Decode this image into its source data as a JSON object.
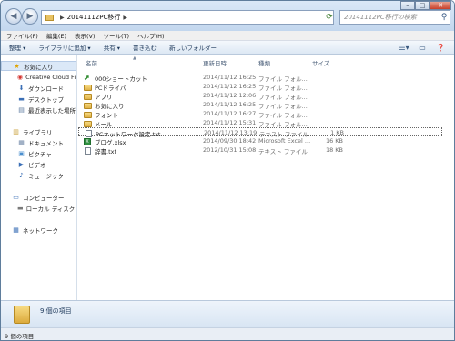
{
  "address": {
    "folder": "20141112PC移行"
  },
  "search": {
    "placeholder": "20141112PC移行の検索"
  },
  "menu": [
    "ファイル(F)",
    "編集(E)",
    "表示(V)",
    "ツール(T)",
    "ヘルプ(H)"
  ],
  "toolbar": [
    "整理 ▾",
    "ライブラリに追加 ▾",
    "共有 ▾",
    "書き込む",
    "新しいフォルダー"
  ],
  "nav": {
    "favorites": "お気に入り",
    "creative_cloud": "Creative Cloud Files",
    "downloads": "ダウンロード",
    "desktop": "デスクトップ",
    "recent": "最近表示した場所",
    "libraries": "ライブラリ",
    "documents": "ドキュメント",
    "pictures": "ピクチャ",
    "videos": "ビデオ",
    "music": "ミュージック",
    "computer": "コンピューター",
    "local_disk": "ローカル ディスク (C:)",
    "network": "ネットワーク"
  },
  "columns": {
    "name": "名前",
    "date": "更新日時",
    "type": "種類",
    "size": "サイズ"
  },
  "files": [
    {
      "name": "000ショートカット",
      "date": "2014/11/12 16:25",
      "type": "ファイル フォル...",
      "size": "",
      "icon": "shortcut-icon"
    },
    {
      "name": "PCドライバ",
      "date": "2014/11/12 16:25",
      "type": "ファイル フォル...",
      "size": "",
      "icon": "folder-icon"
    },
    {
      "name": "アプリ",
      "date": "2014/11/12 12:06",
      "type": "ファイル フォル...",
      "size": "",
      "icon": "folder-icon"
    },
    {
      "name": "お気に入り",
      "date": "2014/11/12 16:25",
      "type": "ファイル フォル...",
      "size": "",
      "icon": "folder-icon"
    },
    {
      "name": "フォント",
      "date": "2014/11/12 16:27",
      "type": "ファイル フォル...",
      "size": "",
      "icon": "folder-icon"
    },
    {
      "name": "メール",
      "date": "2014/11/12 15:31",
      "type": "ファイル フォル...",
      "size": "",
      "icon": "folder-icon"
    },
    {
      "name": "PCネットワーク設定.txt",
      "date": "2014/11/12 13:19",
      "type": "テキスト ファイル",
      "size": "1 KB",
      "icon": "text-file-icon"
    },
    {
      "name": "ブログ.xlsx",
      "date": "2014/09/30 18:42",
      "type": "Microsoft Excel ...",
      "size": "16 KB",
      "icon": "excel-file-icon"
    },
    {
      "name": "辞書.txt",
      "date": "2012/10/31 15:08",
      "type": "テキスト ファイル",
      "size": "18 KB",
      "icon": "text-file-icon"
    }
  ],
  "details": {
    "count": "9 個の項目"
  },
  "status": {
    "count": "9 個の項目"
  }
}
